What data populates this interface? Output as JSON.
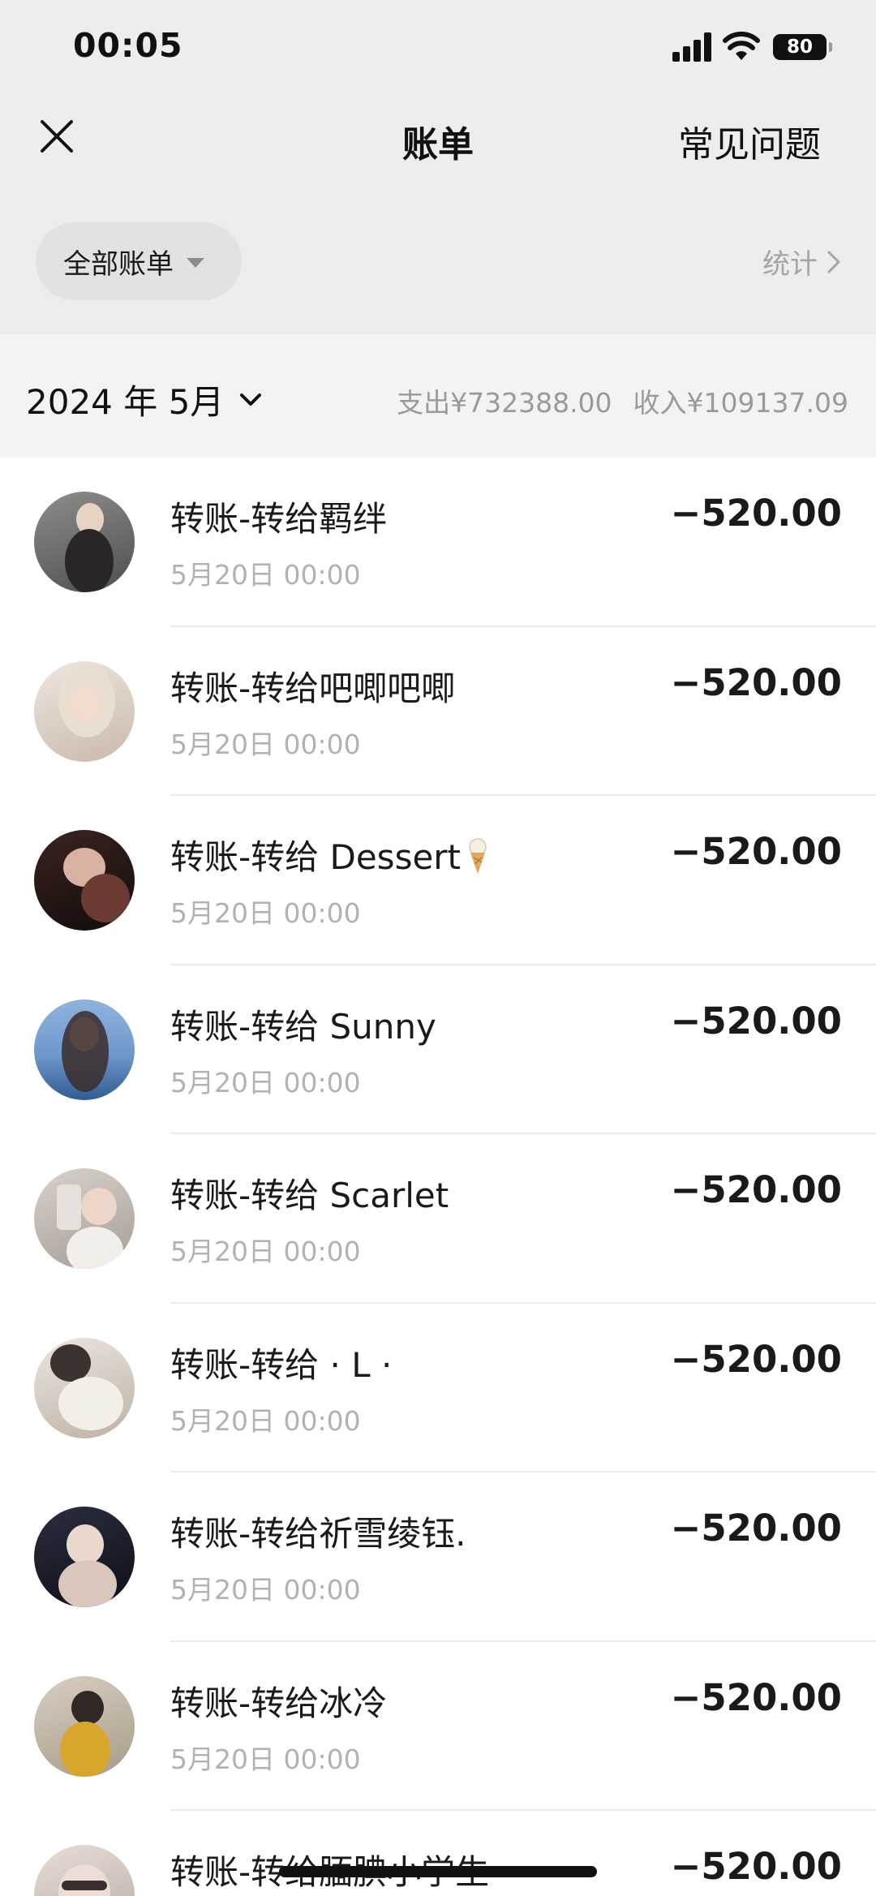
{
  "status_bar": {
    "time": "00:05",
    "battery": "80",
    "icons": [
      "signal-icon",
      "wifi-icon",
      "battery-icon"
    ]
  },
  "header": {
    "title": "账单",
    "close_icon": "close-icon",
    "faq_label": "常见问题"
  },
  "filter": {
    "label": "全部账单",
    "stats_label": "统计"
  },
  "month": {
    "label": "2024 年 5月",
    "expense": "支出¥732388.00",
    "income": "收入¥109137.09"
  },
  "transactions": [
    {
      "title": "转账-转给羁绊",
      "date": "5月20日 00:00",
      "amount": "−520.00"
    },
    {
      "title": "转账-转给吧唧吧唧",
      "date": "5月20日 00:00",
      "amount": "−520.00"
    },
    {
      "title": "转账-转给 Dessert",
      "emoji": "ice-cream-icon",
      "date": "5月20日 00:00",
      "amount": "−520.00"
    },
    {
      "title": "转账-转给 Sunny",
      "date": "5月20日 00:00",
      "amount": "−520.00"
    },
    {
      "title": "转账-转给 Scarlet",
      "date": "5月20日 00:00",
      "amount": "−520.00"
    },
    {
      "title": "转账-转给 · L ·",
      "date": "5月20日 00:00",
      "amount": "−520.00"
    },
    {
      "title": "转账-转给祈雪绫钰.",
      "date": "5月20日 00:00",
      "amount": "−520.00"
    },
    {
      "title": "转账-转给冰冷",
      "date": "5月20日 00:00",
      "amount": "−520.00"
    },
    {
      "title": "转账-转给腼腆小学生",
      "date": "",
      "amount": "−520.00"
    }
  ],
  "colors": {
    "header_bg": "#ededed",
    "month_bar_bg": "#f3f3f3",
    "secondary_text": "#b2b2b2",
    "summary_text": "#9a9a9a"
  }
}
